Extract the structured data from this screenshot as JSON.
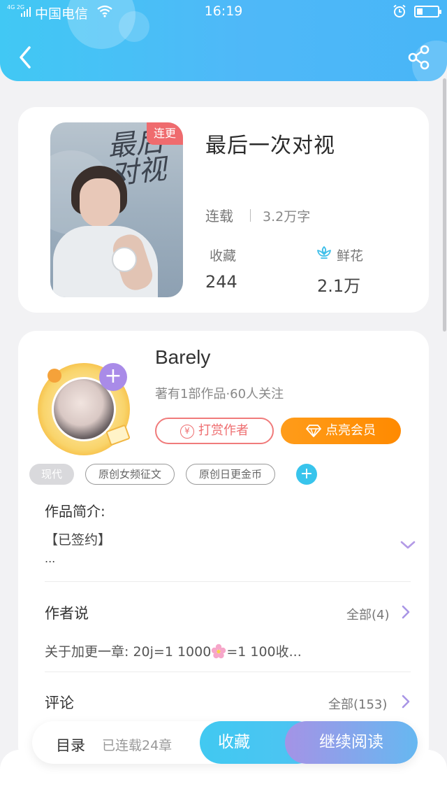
{
  "status_bar": {
    "network": "4G 2G",
    "carrier": "中国电信",
    "time": "16:19",
    "battery_percent": 20
  },
  "header": {
    "back_icon": "chevron-left-icon",
    "share_icon": "share-icon",
    "accent": "#41c8f4"
  },
  "book": {
    "badge": "连更",
    "title": "最后一次对视",
    "status": "连载",
    "word_count": "3.2万字",
    "favorites_label": "收藏",
    "favorites_count": "244",
    "flowers_label": "鲜花",
    "flowers_count": "2.1万"
  },
  "author": {
    "name": "Barely",
    "stats": "著有1部作品·60人关注",
    "follow_label": "+",
    "tip_label": "打赏作者",
    "tip_icon": "¥",
    "vip_label": "点亮会员"
  },
  "tags": [
    "现代",
    "原创女频征文",
    "原创日更金币"
  ],
  "tag_add_label": "+",
  "intro": {
    "title": "作品简介:",
    "text": "【已签约】",
    "more": "..."
  },
  "author_says": {
    "title": "作者说",
    "all": "全部(4)",
    "text_before": "关于加更一章:  20j=1 1000",
    "text_after": "=1 100收..."
  },
  "comments": {
    "title": "评论",
    "all": "全部(153)"
  },
  "bottom_bar": {
    "toc_label": "目录",
    "toc_count": "已连载24章",
    "favorite_button": "收藏",
    "read_button": "继续阅读"
  }
}
